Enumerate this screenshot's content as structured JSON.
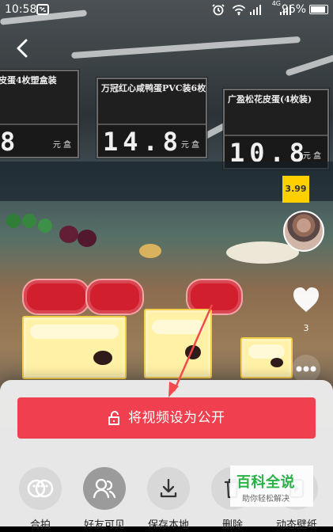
{
  "status_bar": {
    "time": "10:58",
    "network": "4G",
    "battery": "96%",
    "battery_level": 0.96
  },
  "video": {
    "price_signs": [
      {
        "title": "皮蛋4枚塑盒装",
        "price": "8",
        "unit": "元\n盒"
      },
      {
        "title": "万冠红心咸鸭蛋PVC装6枚",
        "price": "14.8",
        "unit": "元\n盒"
      },
      {
        "title": "广盈松花皮蛋(4枚装)",
        "price": "10.8",
        "unit": "元\n盒"
      }
    ],
    "small_price": "3.99",
    "like_count": "3"
  },
  "panel": {
    "primary_action": "将视频设为公开",
    "actions": [
      {
        "label": "合拍",
        "icon": "duet-icon"
      },
      {
        "label": "好友可见",
        "icon": "friends-icon"
      },
      {
        "label": "保存本地",
        "icon": "download-icon"
      },
      {
        "label": "删除",
        "icon": "trash-icon"
      },
      {
        "label": "动态壁纸",
        "icon": "wallpaper-icon"
      }
    ]
  },
  "watermark": {
    "title": "百科全说",
    "subtitle": "助你轻松解决"
  },
  "colors": {
    "primary_red": "#f0404f",
    "panel_bg": "#ebebeb",
    "watermark_green": "#28b246"
  }
}
